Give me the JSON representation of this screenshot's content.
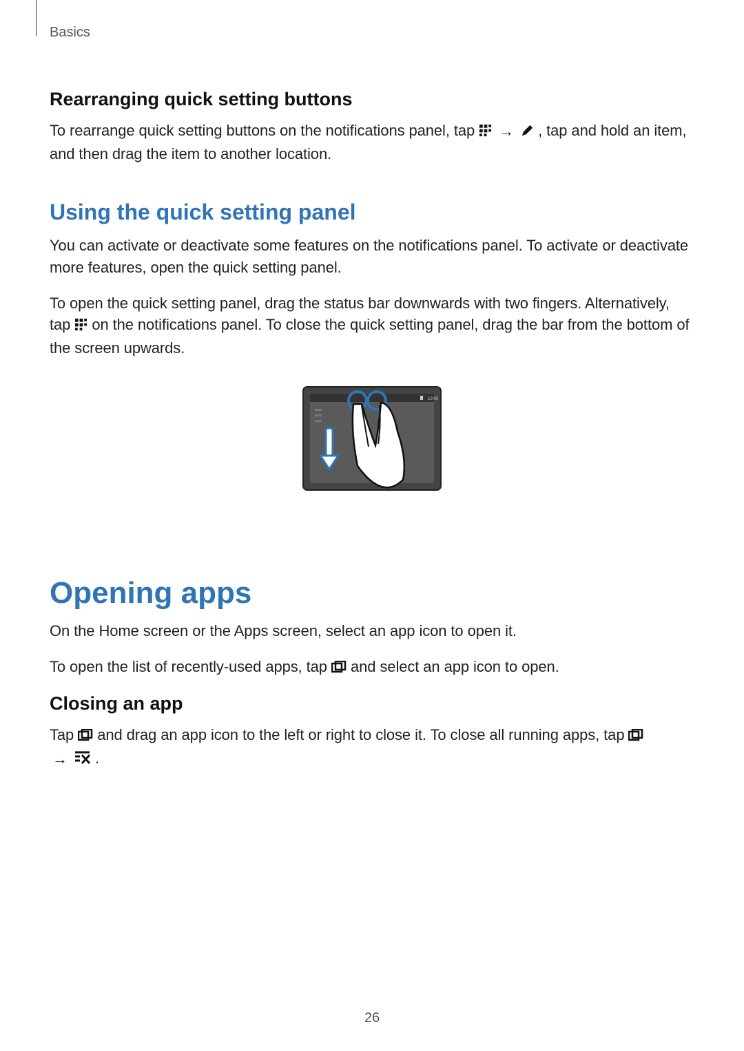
{
  "page": {
    "section_label": "Basics",
    "page_number": "26"
  },
  "rearranging": {
    "heading": "Rearranging quick setting buttons",
    "para_before_icons": "To rearrange quick setting buttons on the notifications panel, tap ",
    "para_after_icons": ", tap and hold an item, and then drag the item to another location."
  },
  "using_panel": {
    "heading": "Using the quick setting panel",
    "p1": "You can activate or deactivate some features on the notifications panel. To activate or deactivate more features, open the quick setting panel.",
    "p2_before": "To open the quick setting panel, drag the status bar downwards with two fingers. Alternatively, tap ",
    "p2_after": " on the notifications panel. To close the quick setting panel, drag the bar from the bottom of the screen upwards."
  },
  "opening_apps": {
    "heading": "Opening apps",
    "p1": "On the Home screen or the Apps screen, select an app icon to open it.",
    "p2_before": "To open the list of recently-used apps, tap ",
    "p2_after": " and select an app icon to open."
  },
  "closing_app": {
    "heading": "Closing an app",
    "p_before": "Tap ",
    "p_mid": " and drag an app icon to the left or right to close it. To close all running apps, tap ",
    "p_after": "."
  },
  "icons": {
    "grid_edit": "grid-edit-icon",
    "pencil": "pencil-icon",
    "recent_apps": "recent-apps-icon",
    "close_all": "close-all-icon",
    "arrow": "→"
  },
  "illustration": {
    "time": "10:00"
  }
}
